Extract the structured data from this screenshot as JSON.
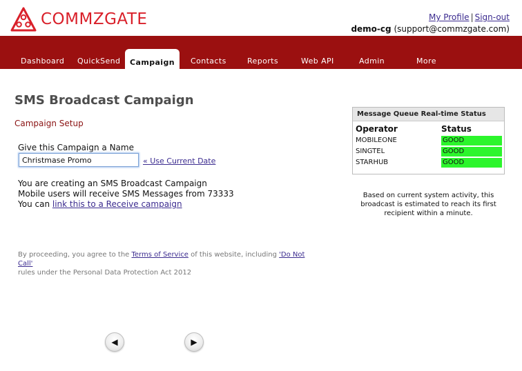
{
  "brand": {
    "name": "COMMZGATE",
    "color": "#d9202a"
  },
  "user": {
    "profile_label": "My Profile",
    "separator": "|",
    "signout_label": "Sign-out",
    "username": "demo-cg",
    "email": "(support@commzgate.com)"
  },
  "nav": {
    "bar_color": "#9b1010",
    "tabs": [
      {
        "label": "Dashboard"
      },
      {
        "label": "QuickSend"
      },
      {
        "label": "Campaign"
      },
      {
        "label": "Contacts"
      },
      {
        "label": "Reports"
      },
      {
        "label": "Web API"
      },
      {
        "label": "Admin"
      },
      {
        "label": "More"
      }
    ],
    "active": "Campaign"
  },
  "page": {
    "title": "SMS Broadcast Campaign",
    "section": "Campaign Setup"
  },
  "form": {
    "name_label": "Give this Campaign a Name",
    "name_value": "Christmase Promo",
    "use_date_label": "« Use Current Date"
  },
  "info": {
    "line1": "You are creating an SMS Broadcast Campaign",
    "line2": "Mobile users will receive SMS Messages from 73333",
    "line3_prefix": "You can ",
    "line3_link": "link this to a Receive campaign"
  },
  "disclaimer": {
    "text1": "By proceeding, you agree to the ",
    "tos_link": "Terms of Service",
    "text2": " of this website, including ",
    "dnc_link": "'Do Not Call'",
    "text3": "rules under the Personal Data Protection Act 2012"
  },
  "queue": {
    "title": "Message Queue Real-time Status",
    "col_operator": "Operator",
    "col_status": "Status",
    "status_color": "#2cf52c",
    "rows": [
      {
        "operator": "MOBILEONE",
        "status": "GOOD"
      },
      {
        "operator": "SINGTEL",
        "status": "GOOD"
      },
      {
        "operator": "STARHUB",
        "status": "GOOD"
      }
    ]
  },
  "estimate": {
    "text": "Based on current system activity, this broadcast is estimated to reach its first recipient within a minute."
  },
  "pager": {
    "prev_icon": "◀",
    "next_icon": "▶"
  }
}
